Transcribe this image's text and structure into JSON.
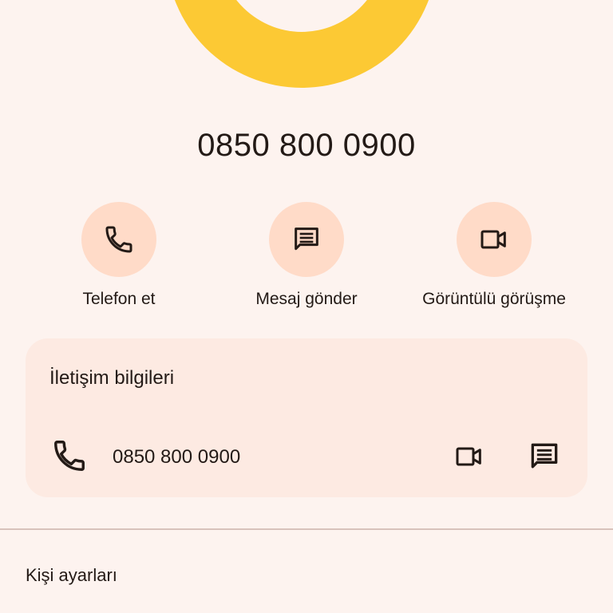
{
  "contact": {
    "title": "0850 800 0900"
  },
  "actions": [
    {
      "label": "Telefon et",
      "icon": "phone-icon"
    },
    {
      "label": "Mesaj gönder",
      "icon": "message-icon"
    },
    {
      "label": "Görüntülü görüşme",
      "icon": "video-call-icon"
    }
  ],
  "contact_info": {
    "title": "İletişim bilgileri",
    "phone": "0850 800 0900",
    "icons": [
      "phone-icon",
      "video-call-icon",
      "message-icon"
    ]
  },
  "settings": {
    "label": "Kişi ayarları"
  },
  "colors": {
    "background": "#fdf3ef",
    "avatar_ring": "#fcc934",
    "action_circle": "#ffdbc8",
    "card": "#fdeae2",
    "text": "#231a16"
  }
}
